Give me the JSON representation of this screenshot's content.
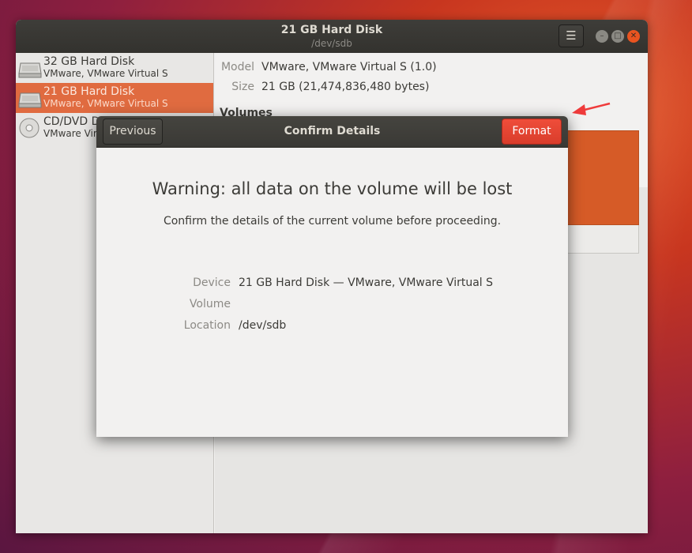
{
  "window": {
    "title": "21 GB Hard Disk",
    "subtitle": "/dev/sdb",
    "menu_icon": "hamburger-icon"
  },
  "sidebar": {
    "items": [
      {
        "name": "32 GB Hard Disk",
        "model": "VMware, VMware Virtual S",
        "icon": "hard-disk-icon",
        "selected": false
      },
      {
        "name": "21 GB Hard Disk",
        "model": "VMware, VMware Virtual S",
        "icon": "hard-disk-icon",
        "selected": true
      },
      {
        "name": "CD/DVD D",
        "model": "VMware Vir",
        "icon": "optical-disc-icon",
        "selected": false
      }
    ]
  },
  "details": {
    "model_label": "Model",
    "model_value": "VMware, VMware Virtual S (1.0)",
    "size_label": "Size",
    "size_value": "21 GB (21,474,836,480 bytes)",
    "volumes_heading": "Volumes"
  },
  "dialog": {
    "title": "Confirm Details",
    "previous_label": "Previous",
    "format_label": "Format",
    "warning": "Warning: all data on the volume will be lost",
    "subtitle": "Confirm the details of the current volume before proceeding.",
    "rows": [
      {
        "label": "Device",
        "value": "21 GB Hard Disk — VMware, VMware Virtual S"
      },
      {
        "label": "Volume",
        "value": ""
      },
      {
        "label": "Location",
        "value": "/dev/sdb"
      }
    ]
  },
  "colors": {
    "accent": "#e95420",
    "selected_row": "#e06b40",
    "format_button": "#e2412f",
    "partition": "#d65b27",
    "annotation_arrow": "#ef3b3b"
  }
}
